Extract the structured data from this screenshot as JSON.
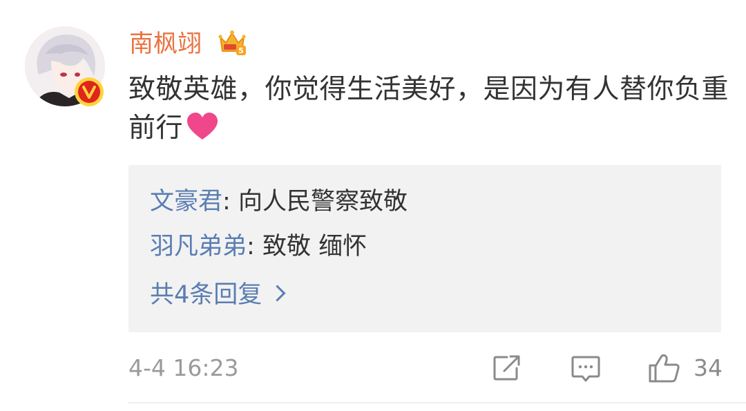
{
  "comment": {
    "username": "南枫翊",
    "content": "致敬英雄，你觉得生活美好，是因为有人替你负重前行",
    "timestamp": "4-4 16:23",
    "like_count": "34"
  },
  "replies": {
    "items": [
      {
        "name": "文豪君",
        "separator": ": ",
        "text": "向人民警察致敬"
      },
      {
        "name": "羽凡弟弟",
        "separator": ": ",
        "text": "致敬 缅怀"
      }
    ],
    "more_label": "共4条回复"
  },
  "icons": {
    "verified": "verified-v-badge-icon",
    "member": "crown-member-icon",
    "emoji": "pink-heart-emoji-icon",
    "share": "share-icon",
    "comment": "comment-icon",
    "like": "thumbs-up-icon"
  },
  "colors": {
    "username": "#eb7340",
    "reply_name": "#5a7db2",
    "reply_bg": "#f2f2f2",
    "meta": "#9a9a9a",
    "heart": "#f0478c",
    "badge": "#e0251c"
  }
}
